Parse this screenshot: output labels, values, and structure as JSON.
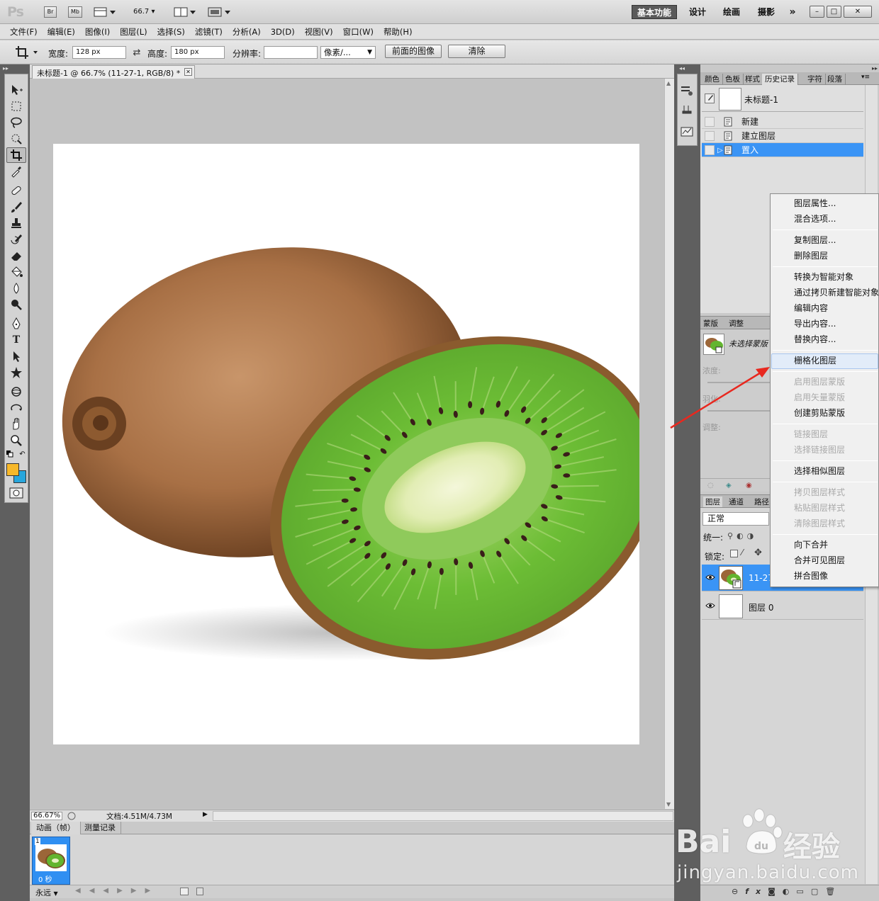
{
  "app": {
    "logo": "Ps",
    "br_label": "Br",
    "mb_label": "Mb",
    "zoom_level": "66.7"
  },
  "workspaces": {
    "essentials": "基本功能",
    "design": "设计",
    "painting": "绘画",
    "photography": "摄影",
    "more": "»"
  },
  "window_controls": {
    "minimize": "–",
    "restore": "□",
    "close": "✕"
  },
  "menu": [
    "文件(F)",
    "编辑(E)",
    "图像(I)",
    "图层(L)",
    "选择(S)",
    "滤镜(T)",
    "分析(A)",
    "3D(D)",
    "视图(V)",
    "窗口(W)",
    "帮助(H)"
  ],
  "options": {
    "width_label": "宽度:",
    "width_value": "128 px",
    "height_label": "高度:",
    "height_value": "180 px",
    "resolution_label": "分辨率:",
    "resolution_value": "",
    "unit": "像素/...",
    "front_image_button": "前面的图像",
    "clear_button": "清除"
  },
  "document": {
    "tab_title": "未标题-1 @ 66.7% (11-27-1, RGB/8) *",
    "zoom_status": "66.67%",
    "doc_size": "文档:4.51M/4.73M"
  },
  "animation": {
    "tab_animation": "动画（帧）",
    "tab_measure": "测量记录",
    "frame_number": "1",
    "frame_delay": "0 秒",
    "loop": "永远"
  },
  "right_panel": {
    "tabs": [
      "颜色",
      "色板",
      "样式",
      "历史记录",
      "字符",
      "段落"
    ],
    "active_tab": "历史记录",
    "snapshot_name": "未标题-1",
    "history": [
      "新建",
      "建立图层",
      "置入"
    ],
    "mask_tabs": [
      "蒙版",
      "调整"
    ],
    "mask_label": "未选择蒙版",
    "density_label": "浓度:",
    "feather_label": "羽化:",
    "adjust_label": "调整:",
    "layers_tabs": [
      "图层",
      "通道",
      "路径"
    ],
    "blend_mode": "正常",
    "unify_label": "统一:",
    "lock_label": "锁定:",
    "layers": [
      "11-27-1",
      "图层 0"
    ]
  },
  "context_menu": {
    "items": [
      {
        "label": "图层属性...",
        "enabled": true
      },
      {
        "label": "混合选项...",
        "enabled": true
      },
      {
        "label": "复制图层...",
        "enabled": true
      },
      {
        "label": "删除图层",
        "enabled": true
      },
      {
        "label": "转换为智能对象",
        "enabled": true
      },
      {
        "label": "通过拷贝新建智能对象",
        "enabled": true
      },
      {
        "label": "编辑内容",
        "enabled": true
      },
      {
        "label": "导出内容...",
        "enabled": true
      },
      {
        "label": "替换内容...",
        "enabled": true
      },
      {
        "label": "栅格化图层",
        "enabled": true,
        "highlighted": true
      },
      {
        "label": "启用图层蒙版",
        "enabled": false
      },
      {
        "label": "启用矢量蒙版",
        "enabled": false
      },
      {
        "label": "创建剪贴蒙版",
        "enabled": true
      },
      {
        "label": "链接图层",
        "enabled": false
      },
      {
        "label": "选择链接图层",
        "enabled": false
      },
      {
        "label": "选择相似图层",
        "enabled": true
      },
      {
        "label": "拷贝图层样式",
        "enabled": false
      },
      {
        "label": "粘贴图层样式",
        "enabled": false
      },
      {
        "label": "清除图层样式",
        "enabled": false
      },
      {
        "label": "向下合并",
        "enabled": true
      },
      {
        "label": "合并可见图层",
        "enabled": true
      },
      {
        "label": "拼合图像",
        "enabled": true
      }
    ]
  },
  "watermark": {
    "brand": "Bai",
    "brand_cn": "经验",
    "url": "jingyan.baidu.com"
  },
  "colors": {
    "foreground": "#f7b829",
    "background": "#28a6dc",
    "selection": "#3a94f5",
    "annotation_arrow": "#e8281f"
  }
}
